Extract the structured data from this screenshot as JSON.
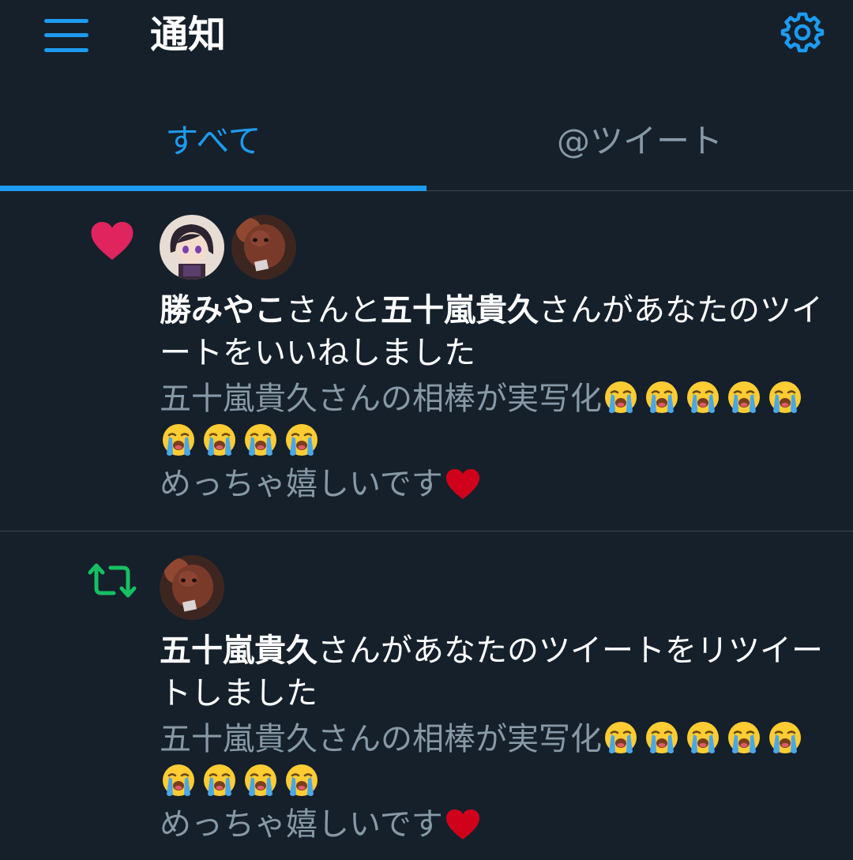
{
  "header": {
    "title": "通知",
    "menu_icon": "hamburger-menu-icon",
    "settings_icon": "gear-icon",
    "accent": "#1d9bf0"
  },
  "tabs": [
    {
      "label": "すべて",
      "selected": true
    },
    {
      "label": "@ツイート",
      "selected": false
    }
  ],
  "notifications": [
    {
      "type_icon": "heart-icon",
      "type_color": "#e0245e",
      "users": [
        "勝みやこ",
        "五十嵐貴久"
      ],
      "text_parts": [
        "勝みやこ",
        "さんと",
        "五十嵐貴久",
        "さんがあなたのツイートをいいねしました"
      ],
      "tweet_line1": "五十嵐貴久さんの相棒が実写化",
      "tweet_line3": "めっちゃ嬉しいです",
      "emoji": "loudly-crying-face",
      "emoji_count": 9
    },
    {
      "type_icon": "retweet-icon",
      "type_color": "#17bf63",
      "users": [
        "五十嵐貴久"
      ],
      "text_parts": [
        "五十嵐貴久",
        "さんがあなたのツイートをリツイートしました"
      ],
      "tweet_line1": "五十嵐貴久さんの相棒が実写化",
      "tweet_line3": "めっちゃ嬉しいです",
      "emoji": "loudly-crying-face",
      "emoji_count": 9
    }
  ]
}
